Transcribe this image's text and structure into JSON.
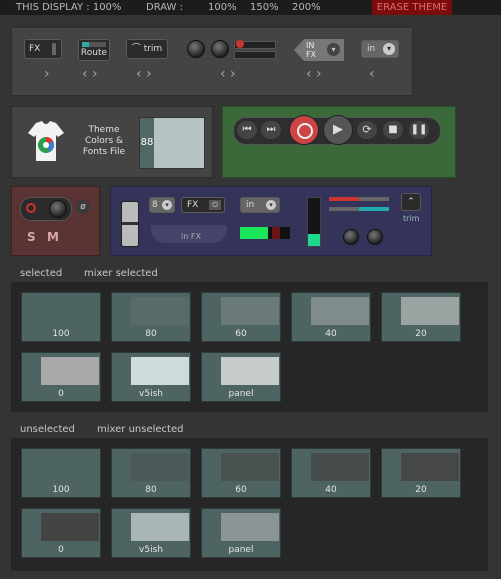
{
  "topbar": {
    "this_display": "THIS DISPLAY : 100%",
    "draw": "DRAW :",
    "zoom_100": "100%",
    "zoom_150": "150%",
    "zoom_200": "200%",
    "erase": "ERASE THEME"
  },
  "toolbar": {
    "fx": "FX",
    "route": "Route",
    "trim": "trim",
    "in_fx_top": "IN",
    "in_fx_bottom": "FX",
    "in": "in"
  },
  "theme": {
    "label": "Theme Colors & Fonts File",
    "value": "88"
  },
  "mixer": {
    "s": "S",
    "m": "M",
    "num": "8",
    "fx": "FX",
    "in": "in",
    "infx": "in FX",
    "trim": "trim"
  },
  "sections": {
    "selected": {
      "title": "selected",
      "subtitle": "mixer selected",
      "swatches": [
        {
          "label": "100",
          "color": "#4d6463"
        },
        {
          "label": "80",
          "color": "#566b6a"
        },
        {
          "label": "60",
          "color": "#6a7a79"
        },
        {
          "label": "40",
          "color": "#7f8c8b"
        },
        {
          "label": "20",
          "color": "#9aa3a2"
        },
        {
          "label": "0",
          "color": "#a9a9a9"
        },
        {
          "label": "v5ish",
          "color": "#d0dcdc"
        },
        {
          "label": "panel",
          "color": "#c6cccc"
        }
      ]
    },
    "unselected": {
      "title": "unselected",
      "subtitle": "mixer unselected",
      "swatches": [
        {
          "label": "100",
          "color": "#4d6463"
        },
        {
          "label": "80",
          "color": "#4b5958"
        },
        {
          "label": "60",
          "color": "#4a5151"
        },
        {
          "label": "40",
          "color": "#474d4d"
        },
        {
          "label": "20",
          "color": "#464848"
        },
        {
          "label": "0",
          "color": "#444444"
        },
        {
          "label": "v5ish",
          "color": "#aab6b5"
        },
        {
          "label": "panel",
          "color": "#8b9595"
        }
      ]
    }
  }
}
